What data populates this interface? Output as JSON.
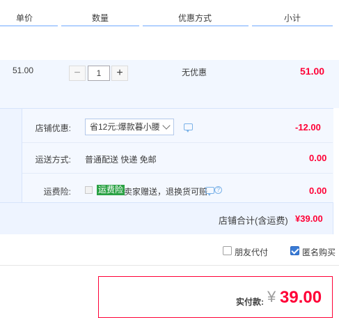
{
  "header": {
    "col_price": "单价",
    "col_qty": "数量",
    "col_discount": "优惠方式",
    "col_subtotal": "小计"
  },
  "item": {
    "unit_price": "51.00",
    "qty_minus": "−",
    "qty_value": "1",
    "qty_plus": "+",
    "discount": "无优惠",
    "subtotal": "51.00"
  },
  "store": {
    "coupon_label": "店铺优惠:",
    "coupon_selected": "省12元:爆款暮小腰",
    "coupon_amount": "-12.00",
    "shipping_label": "运送方式:",
    "shipping_value": "普通配送 快递 免邮",
    "shipping_amount": "0.00",
    "insurance_label": "运费险:",
    "insurance_tag": "运费险",
    "insurance_text": "卖家赠送，退换货可赔",
    "insurance_amount": "0.00",
    "total_label": "店铺合计(含运费)",
    "total_amount": "¥39.00"
  },
  "options": {
    "friend_pay": "朋友代付",
    "anonymous": "匿名购买"
  },
  "payment": {
    "label": "实付款:",
    "currency": "¥",
    "amount": "39.00"
  },
  "colors": {
    "accent_red": "#ff0036",
    "header_line": "#b2d1ff",
    "panel_bg": "#eef4ff"
  }
}
